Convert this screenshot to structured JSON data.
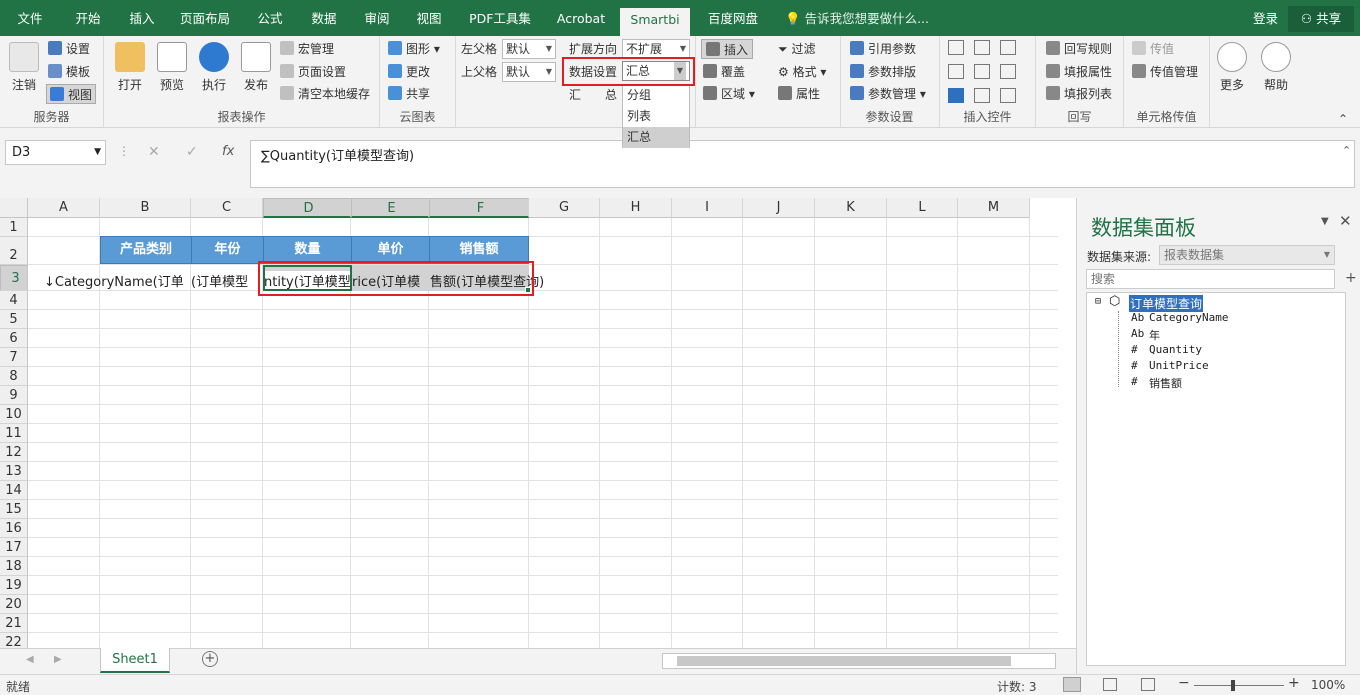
{
  "tabs": [
    "文件",
    "开始",
    "插入",
    "页面布局",
    "公式",
    "数据",
    "审阅",
    "视图",
    "PDF工具集",
    "Acrobat",
    "Smartbi",
    "百度网盘"
  ],
  "active_tab": "Smartbi",
  "tell_me": "告诉我您想要做什么...",
  "login": "登录",
  "share": "共享",
  "ribbon": {
    "server": {
      "logout": "注销",
      "settings": "设置",
      "template": "模板",
      "view": "视图",
      "label": "服务器"
    },
    "report": {
      "open": "打开",
      "preview": "预览",
      "execute": "执行",
      "publish": "发布",
      "macro": "宏管理",
      "page_setup": "页面设置",
      "clear_cache": "清空本地缓存",
      "label": "报表操作"
    },
    "cloud": {
      "graphic": "图形",
      "change": "更改",
      "share": "共享",
      "label": "云图表"
    },
    "parent": {
      "left": "左父格",
      "left_val": "默认",
      "top": "上父格",
      "top_val": "默认"
    },
    "expand": {
      "direction": "扩展方向",
      "direction_val": "不扩展",
      "data_setting": "数据设置",
      "data_setting_val": "汇总",
      "sum1": "汇",
      "sum2": "总"
    },
    "dropdown": [
      "分组",
      "列表",
      "汇总"
    ],
    "insert": {
      "insert": "插入",
      "cover": "覆盖",
      "area": "区域"
    },
    "filter": {
      "filter": "过滤",
      "format": "格式",
      "property": "属性"
    },
    "param": {
      "ref": "引用参数",
      "layout": "参数排版",
      "manage": "参数管理",
      "label": "参数设置"
    },
    "controls": {
      "label": "插入控件"
    },
    "writeback": {
      "rule": "回写规则",
      "fill_prop": "填报属性",
      "fill_list": "填报列表",
      "label": "回写"
    },
    "cellpass": {
      "pass": "传值",
      "pass_manage": "传值管理",
      "label": "单元格传值"
    },
    "more": "更多",
    "help": "帮助"
  },
  "name_box": "D3",
  "formula": "∑Quantity(订单模型查询)",
  "columns": [
    "A",
    "B",
    "C",
    "D",
    "E",
    "F",
    "G",
    "H",
    "I",
    "J",
    "K",
    "L",
    "M"
  ],
  "rows": [
    "1",
    "2",
    "3",
    "4",
    "5",
    "6",
    "7",
    "8",
    "9",
    "10",
    "11",
    "12",
    "13",
    "14",
    "15",
    "16",
    "17",
    "18",
    "19",
    "20",
    "21",
    "22"
  ],
  "header_cells": [
    "产品类别",
    "年份",
    "数量",
    "单价",
    "销售额"
  ],
  "row3": {
    "a": "↓CategoryName(订单",
    "c": "(订单模型",
    "d": "ntity(订单模型",
    "e": "rice(订单模",
    "f": "售额(订单模型查询)"
  },
  "sheet_tab": "Sheet1",
  "status": {
    "ready": "就绪",
    "count": "计数: 3",
    "zoom": "100%"
  },
  "panel": {
    "title": "数据集面板",
    "source_label": "数据集来源:",
    "source_value": "报表数据集",
    "search_placeholder": "搜索",
    "root": "订单模型查询",
    "fields": [
      {
        "type": "Ab",
        "name": "CategoryName"
      },
      {
        "type": "Ab",
        "name": "年"
      },
      {
        "type": "#",
        "name": "Quantity"
      },
      {
        "type": "#",
        "name": "UnitPrice"
      },
      {
        "type": "#",
        "name": "销售额"
      }
    ]
  },
  "colors": {
    "accent": "#217346",
    "header_fill": "#5b9bd5",
    "highlight": "#e02020"
  }
}
